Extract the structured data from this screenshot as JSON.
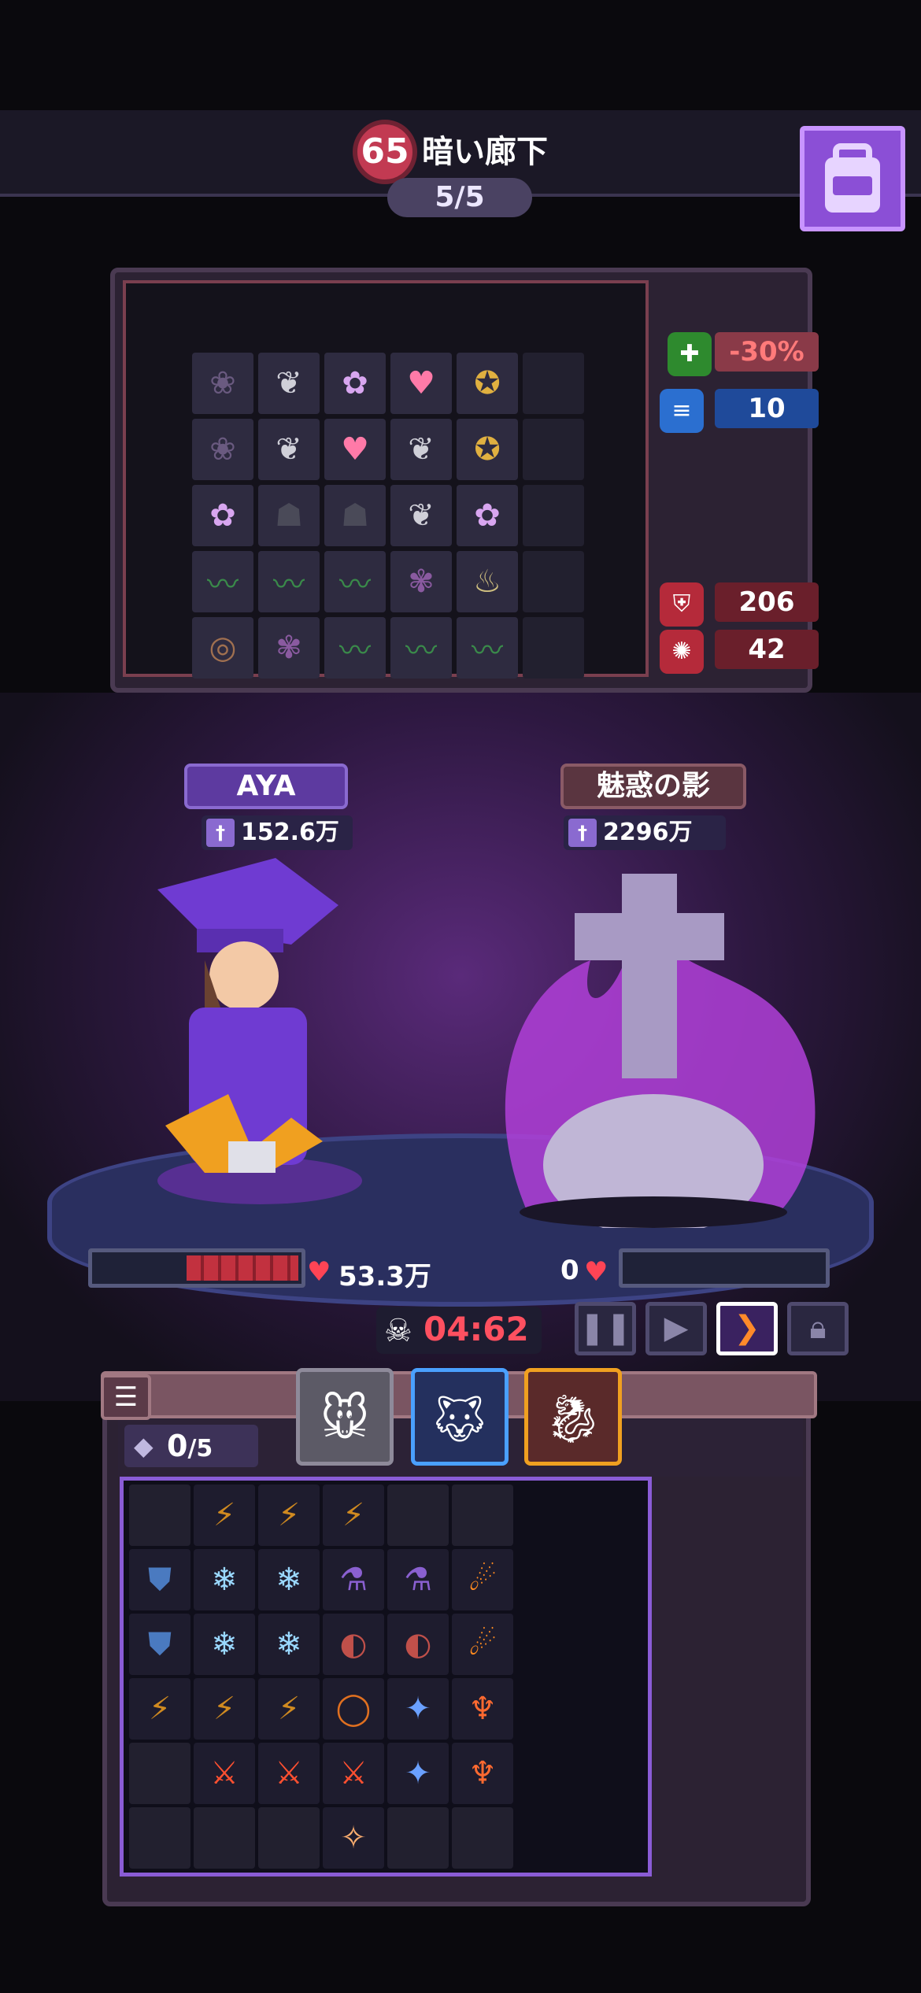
{
  "header": {
    "level": "65",
    "stage_name": "暗い廊下",
    "wave": "5/5",
    "backpack_icon": "backpack-icon"
  },
  "stats": {
    "debuff": "-30%",
    "speed": "10",
    "defense": "206",
    "energy": "42"
  },
  "player": {
    "name": "AYA",
    "power": "152.6万",
    "hp": "53.3万",
    "hp_fraction": 0.55
  },
  "enemy": {
    "name": "魅惑の影",
    "power": "2296万",
    "hp": "0",
    "hp_fraction": 0
  },
  "battle": {
    "timer": "04:62"
  },
  "lower": {
    "slot_count_value": "0",
    "slot_count_max": "/5"
  },
  "inventory_top": [
    [
      "rose-icon",
      "wing-icon",
      "butterfly-icon",
      "heart-potion-icon",
      "medal-icon",
      ""
    ],
    [
      "rose-icon",
      "wing-icon",
      "heart-potion-icon",
      "wing-icon",
      "medal-icon",
      ""
    ],
    [
      "butterfly-icon",
      "cat-icon",
      "cat-icon",
      "wing-icon",
      "butterfly-icon",
      ""
    ],
    [
      "vine-icon",
      "vine-icon",
      "vine-icon",
      "flower-icon",
      "bottle-icon",
      ""
    ],
    [
      "headphones-icon",
      "flower-icon",
      "vine-icon",
      "vine-icon",
      "vine-icon",
      ""
    ]
  ],
  "inventory_bottom": [
    [
      "",
      "lightning-icon",
      "lightning-icon",
      "lightning-icon",
      "",
      ""
    ],
    [
      "shield-icon",
      "ice-shard-icon",
      "ice-shard-icon",
      "potion-icon",
      "potion-icon",
      "fire-bolt-icon"
    ],
    [
      "shield-icon",
      "ice-shard-icon",
      "ice-shard-icon",
      "meat-icon",
      "meat-icon",
      "fire-bolt-icon"
    ],
    [
      "lightning-icon",
      "lightning-icon",
      "lightning-icon",
      "ring-icon",
      "wizard-cat-icon",
      "torch-icon"
    ],
    [
      "",
      "flame-sword-icon",
      "flame-sword-icon",
      "flame-sword-icon",
      "wizard-cat-icon",
      "torch-icon"
    ],
    [
      "",
      "",
      "",
      "fire-wand-icon",
      "",
      ""
    ]
  ],
  "colors": {
    "accent": "#8b4fd6",
    "hp_red": "#c2313f",
    "timer_red": "#ff5060"
  }
}
